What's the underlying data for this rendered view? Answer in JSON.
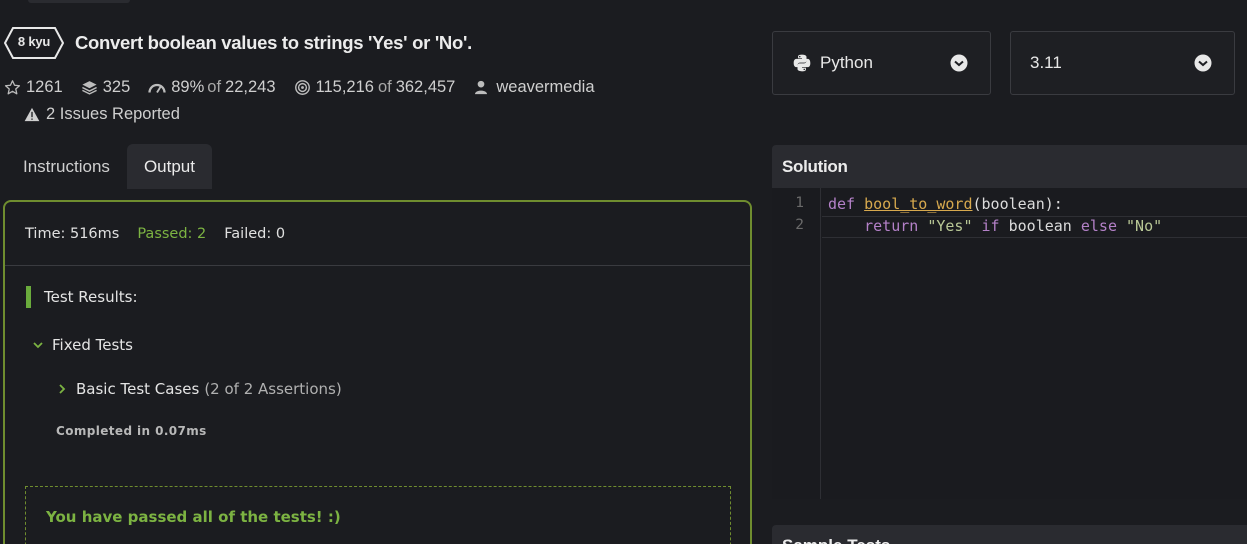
{
  "kata": {
    "rank": "8 kyu",
    "title": "Convert boolean values to strings 'Yes' or 'No'.",
    "stars": "1261",
    "collections": "325",
    "satisfaction": "89%",
    "satisfaction_of": "of",
    "votes_total": "22,243",
    "completed": "115,216",
    "completed_of": "of",
    "attempts_total": "362,457",
    "author": "weavermedia",
    "issues": "2 Issues Reported"
  },
  "tabs": [
    {
      "label": "Instructions",
      "active": false
    },
    {
      "label": "Output",
      "active": true
    }
  ],
  "output": {
    "time": "Time: 516ms",
    "passed": "Passed: 2",
    "failed": "Failed: 0",
    "results_heading": "Test Results:",
    "group_label": "Fixed Tests",
    "subgroup_label": "Basic Test Cases",
    "subgroup_assertions": "(2 of 2 Assertions)",
    "completed_in": "Completed in 0.07ms",
    "passed_message": "You have passed all of the tests! :)"
  },
  "language_select": {
    "value": "Python",
    "icon": "python-icon"
  },
  "version_select": {
    "value": "3.11"
  },
  "solution": {
    "heading": "Solution",
    "line_numbers": [
      "1",
      "2"
    ],
    "line1": {
      "kw": "def",
      "fn": "bool_to_word",
      "rest": "(boolean):"
    },
    "line2": {
      "indent": "    ",
      "kw1": "return",
      "s1": "\"Yes\"",
      "kw2": "if",
      "mid": "boolean",
      "kw3": "else",
      "s2": "\"No\""
    }
  },
  "sample_tests": {
    "heading": "Sample Tests"
  },
  "colors": {
    "background": "#1b1c20",
    "accent_green": "#7cb342",
    "panel_border": "#6f8d2f",
    "keyword": "#b481c8",
    "function": "#d7a94e",
    "string": "#b9c896"
  }
}
